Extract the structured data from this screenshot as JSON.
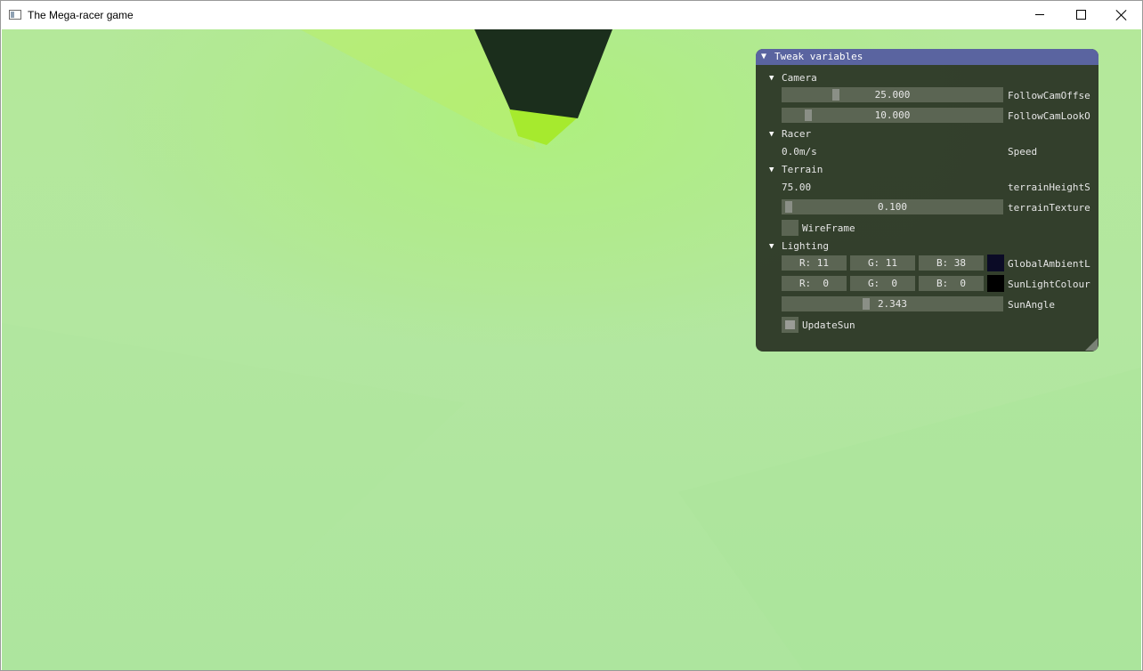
{
  "window": {
    "title": "The Mega-racer game"
  },
  "panel": {
    "title": "Tweak variables",
    "camera": {
      "header": "Camera",
      "follow_cam_offset": {
        "value": "25.000",
        "label": "FollowCamOffse",
        "fraction": 0.25
      },
      "follow_cam_look": {
        "value": "10.000",
        "label": "FollowCamLookO",
        "fraction": 0.12
      }
    },
    "racer": {
      "header": "Racer",
      "speed_value": "0.0m/s",
      "speed_label": "Speed"
    },
    "terrain": {
      "header": "Terrain",
      "height_value": "75.00",
      "height_label": "terrainHeightS",
      "texture": {
        "value": "0.100",
        "label": "terrainTexture",
        "fraction": 0.02
      },
      "wireframe_label": "WireFrame",
      "wireframe_checked": false
    },
    "lighting": {
      "header": "Lighting",
      "ambient": {
        "r": "R: 11",
        "g": "G: 11",
        "b": "B: 38",
        "label": "GlobalAmbientL",
        "color": "#0b0b26"
      },
      "sunlight": {
        "r": "R:  0",
        "g": "G:  0",
        "b": "B:  0",
        "label": "SunLightColour",
        "color": "#000000"
      },
      "sun_angle": {
        "value": "2.343",
        "label": "SunAngle",
        "fraction": 0.38
      },
      "update_sun_label": "UpdateSun",
      "update_sun_checked": true
    }
  },
  "colors": {
    "terrain": "#b2e89c",
    "racer_body": "#1b2e1c",
    "racer_highlight": "#a8ee2a",
    "panel_bg": "#2e3828",
    "panel_title": "#5a64a0"
  }
}
